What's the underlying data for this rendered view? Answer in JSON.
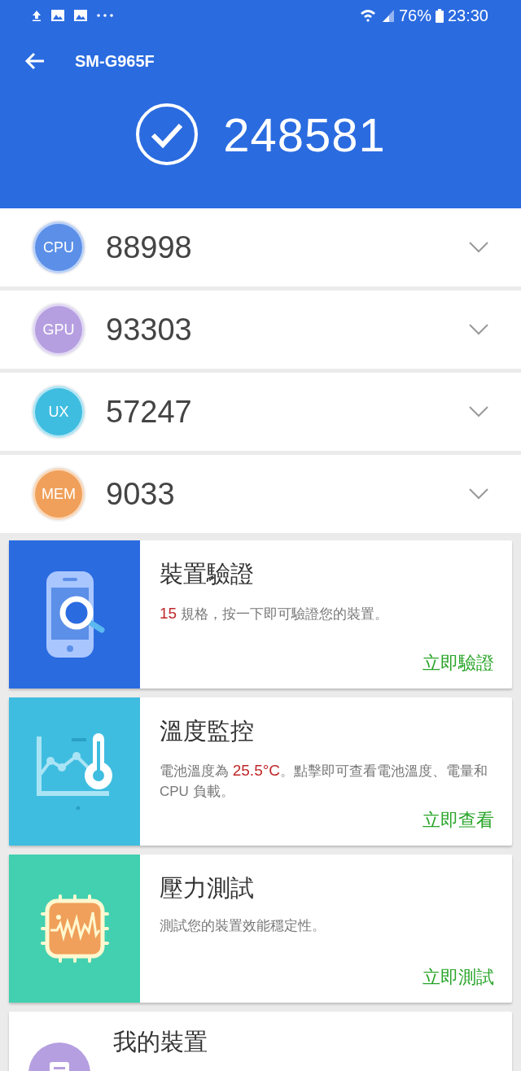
{
  "status_bar": {
    "battery": "76%",
    "time": "23:30"
  },
  "header": {
    "title": "SM-G965F",
    "total_score": "248581"
  },
  "scores": [
    {
      "label": "CPU",
      "value": "88998",
      "color": "#5b8fe8"
    },
    {
      "label": "GPU",
      "value": "93303",
      "color": "#b59fe0"
    },
    {
      "label": "UX",
      "value": "57247",
      "color": "#3fbde0"
    },
    {
      "label": "MEM",
      "value": "9033",
      "color": "#f0a05a"
    }
  ],
  "cards": [
    {
      "kind": "verify",
      "title": "裝置驗證",
      "description": [
        {
          "text": "15",
          "highlight": true
        },
        {
          "text": " 規格，按一下即可驗證您的裝置。",
          "highlight": false
        }
      ],
      "action": "立即驗證"
    },
    {
      "kind": "temperature",
      "title": "溫度監控",
      "description": [
        {
          "text": "電池溫度為 ",
          "highlight": false
        },
        {
          "text": "25.5°C",
          "highlight": true
        },
        {
          "text": "。點擊即可查看電池溫度、電量和 CPU 負載。",
          "highlight": false
        }
      ],
      "action": "立即查看"
    },
    {
      "kind": "stress",
      "title": "壓力測試",
      "description": [
        {
          "text": "測試您的裝置效能穩定性。",
          "highlight": false
        }
      ],
      "action": "立即測試"
    },
    {
      "kind": "device",
      "title": "我的裝置"
    }
  ]
}
